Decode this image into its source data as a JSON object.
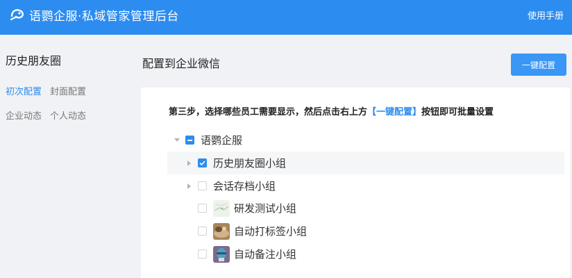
{
  "header": {
    "title": "语鹦企服·私域管家管理后台",
    "manual": "使用手册",
    "logo_icon": "parrot-logo-icon"
  },
  "sidebar": {
    "title": "历史朋友圈",
    "row1": [
      "初次配置",
      "封面配置"
    ],
    "row2": [
      "企业动态",
      "个人动态"
    ]
  },
  "main": {
    "title": "配置到企业微信",
    "button": "一键配置",
    "instruction_prefix": "第三步，选择哪些员工需要显示，然后点击右上方",
    "instruction_highlight": "【一键配置】",
    "instruction_suffix": "按钮即可批量设置"
  },
  "tree": {
    "root": {
      "label": "语鹦企服",
      "state": "partial",
      "expanded": true
    },
    "children": [
      {
        "label": "历史朋友圈小组",
        "state": "checked",
        "expandable": true,
        "avatar": null
      },
      {
        "label": "会话存档小组",
        "state": "unchecked",
        "expandable": true,
        "avatar": null
      },
      {
        "label": "研发测试小组",
        "state": "unchecked",
        "expandable": false,
        "avatar": "map-thumbnail"
      },
      {
        "label": "自动打标签小组",
        "state": "unchecked",
        "expandable": false,
        "avatar": "animal-photo"
      },
      {
        "label": "自动备注小组",
        "state": "unchecked",
        "expandable": false,
        "avatar": "avatar-face"
      }
    ]
  },
  "colors": {
    "primary": "#2d8cf0",
    "button": "#3a97f5",
    "bg": "#f0f2f5"
  }
}
